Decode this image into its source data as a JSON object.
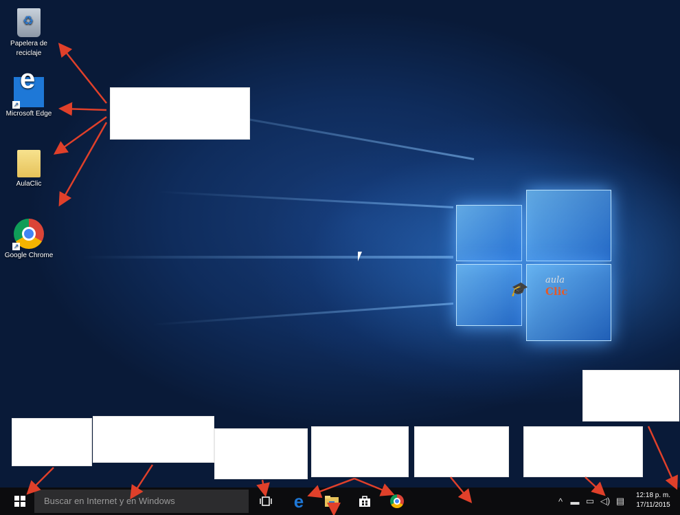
{
  "desktop": {
    "icons": [
      {
        "label": "Papelera de reciclaje",
        "icon": "recycle-bin-icon"
      },
      {
        "label": "Microsoft Edge",
        "icon": "edge-icon"
      },
      {
        "label": "AulaClic",
        "icon": "folder-icon"
      },
      {
        "label": "Google Chrome",
        "icon": "chrome-icon"
      }
    ],
    "watermark": {
      "line1": "aula",
      "line2": "Clic"
    }
  },
  "taskbar": {
    "search_placeholder": "Buscar en Internet y en Windows",
    "pinned": [
      "task-view-icon",
      "edge-icon",
      "file-explorer-icon",
      "store-icon",
      "chrome-icon"
    ],
    "tray_icons": [
      "chevron-up-icon",
      "battery-icon",
      "network-icon",
      "volume-icon",
      "action-center-icon"
    ],
    "clock": {
      "time": "12:18 p. m.",
      "date": "17/11/2015"
    }
  },
  "colors": {
    "arrow": "#e0402a",
    "taskbar": "#0c0c0e",
    "accent": "#1e78d7"
  }
}
